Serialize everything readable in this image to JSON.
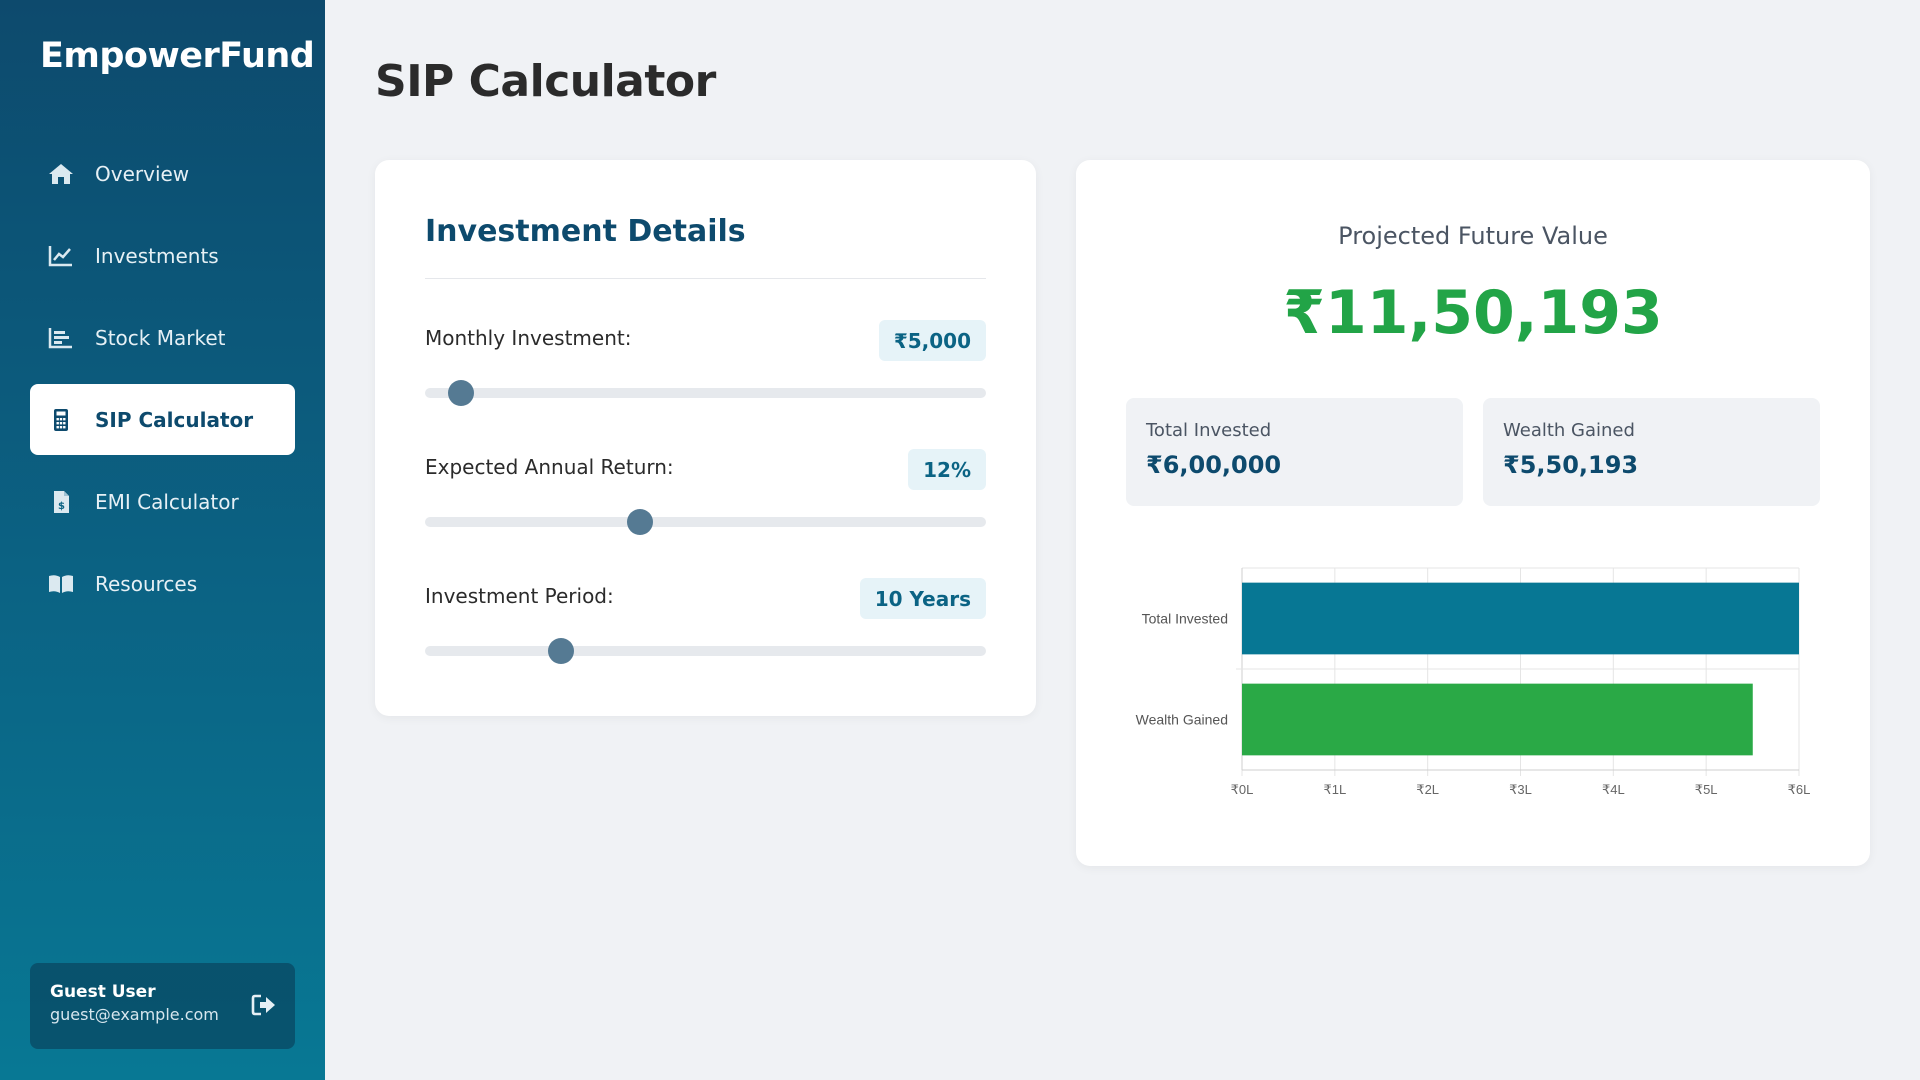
{
  "app": {
    "brand": "EmpowerFund"
  },
  "sidebar": {
    "items": [
      {
        "label": "Overview",
        "icon": "home-icon",
        "active": false
      },
      {
        "label": "Investments",
        "icon": "line-chart-icon",
        "active": false
      },
      {
        "label": "Stock Market",
        "icon": "bar-chart-icon",
        "active": false
      },
      {
        "label": "SIP Calculator",
        "icon": "calculator-icon",
        "active": true
      },
      {
        "label": "EMI Calculator",
        "icon": "invoice-dollar-icon",
        "active": false
      },
      {
        "label": "Resources",
        "icon": "book-open-icon",
        "active": false
      }
    ]
  },
  "user": {
    "name": "Guest User",
    "email": "guest@example.com",
    "action_icon": "logout-icon"
  },
  "page": {
    "title": "SIP Calculator"
  },
  "details": {
    "title": "Investment Details",
    "monthly": {
      "label": "Monthly Investment:",
      "value": "₹5,000",
      "slider_fraction": 0.065
    },
    "return": {
      "label": "Expected Annual Return:",
      "value": "12%",
      "slider_fraction": 0.383
    },
    "period": {
      "label": "Investment Period:",
      "value": "10 Years",
      "slider_fraction": 0.243
    }
  },
  "results": {
    "projected_label": "Projected Future Value",
    "projected_value": "₹11,50,193",
    "total_invested_label": "Total Invested",
    "total_invested_value": "₹6,00,000",
    "wealth_gained_label": "Wealth Gained",
    "wealth_gained_value": "₹5,50,193"
  },
  "colors": {
    "accent": "#0d4a6d",
    "invested_bar": "#077794",
    "gained_bar": "#2aa946",
    "positive": "#22a447"
  },
  "chart_data": {
    "type": "bar",
    "orientation": "horizontal",
    "categories": [
      "Total Invested",
      "Wealth Gained"
    ],
    "values": [
      600000,
      550193
    ],
    "colors": [
      "#077794",
      "#2aa946"
    ],
    "xlim": [
      0,
      600000
    ],
    "x_ticks": [
      0,
      100000,
      200000,
      300000,
      400000,
      500000,
      600000
    ],
    "x_tick_labels": [
      "₹0L",
      "₹1L",
      "₹2L",
      "₹3L",
      "₹4L",
      "₹5L",
      "₹6L"
    ],
    "grid": true,
    "legend": "none"
  }
}
